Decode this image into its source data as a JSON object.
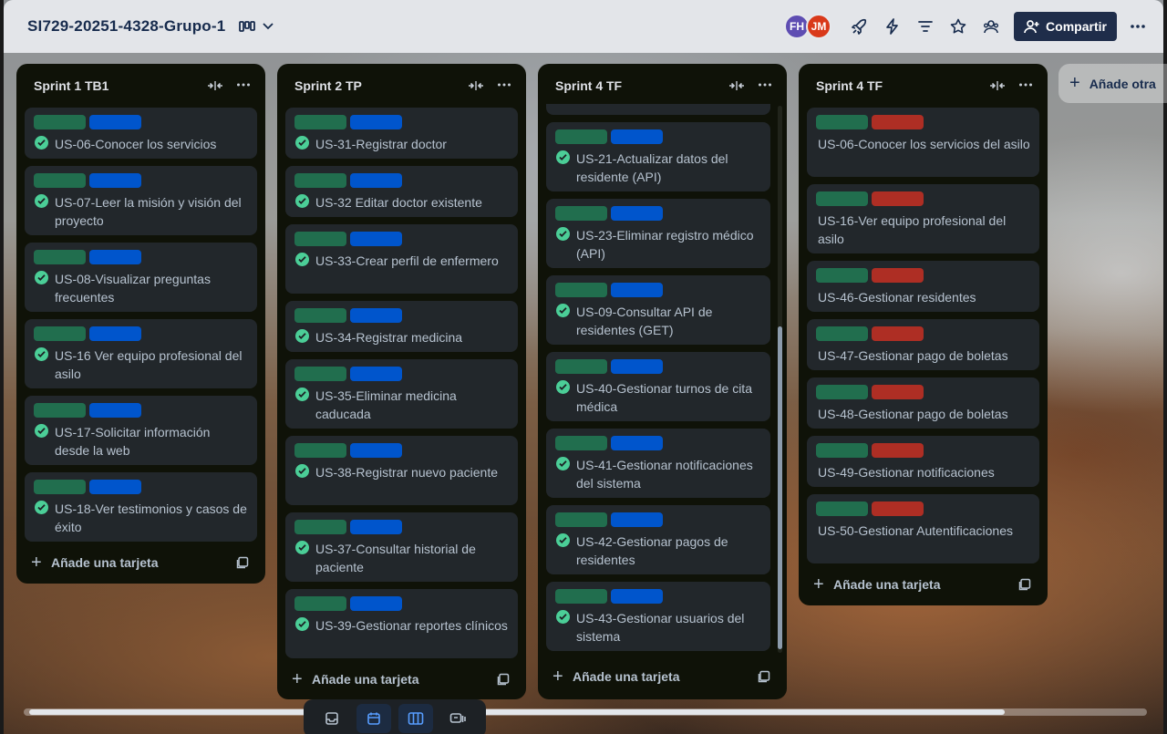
{
  "header": {
    "board_title": "SI729-20251-4328-Grupo-1",
    "share_label": "Compartir",
    "members": [
      "FH",
      "JM"
    ]
  },
  "lists": [
    {
      "title": "Sprint 1 TB1",
      "add_label": "Añade una tarjeta",
      "cards": [
        {
          "text": "US-06-Conocer los servicios",
          "done": true,
          "label2": "blue"
        },
        {
          "text": "US-07-Leer la misión y visión del proyecto",
          "done": true,
          "label2": "blue"
        },
        {
          "text": "US-08-Visualizar preguntas frecuentes",
          "done": true,
          "label2": "blue"
        },
        {
          "text": "US-16 Ver equipo profesional del asilo",
          "done": true,
          "label2": "blue"
        },
        {
          "text": "US-17-Solicitar información desde la web",
          "done": true,
          "label2": "blue"
        },
        {
          "text": "US-18-Ver testimonios y casos de éxito",
          "done": true,
          "label2": "blue"
        }
      ]
    },
    {
      "title": "Sprint 2 TP",
      "add_label": "Añade una tarjeta",
      "cards": [
        {
          "text": "US-31-Registrar doctor",
          "done": true,
          "label2": "blue"
        },
        {
          "text": "US-32 Editar doctor existente",
          "done": true,
          "label2": "blue"
        },
        {
          "text": "US-33-Crear perfil de enfermero",
          "done": true,
          "label2": "blue"
        },
        {
          "text": "US-34-Registrar medicina",
          "done": true,
          "label2": "blue"
        },
        {
          "text": "US-35-Eliminar medicina caducada",
          "done": true,
          "label2": "blue"
        },
        {
          "text": "US-38-Registrar nuevo paciente",
          "done": true,
          "label2": "blue"
        },
        {
          "text": "US-37-Consultar historial de paciente",
          "done": true,
          "label2": "blue"
        },
        {
          "text": "US-39-Gestionar reportes clínicos",
          "done": true,
          "label2": "blue"
        }
      ]
    },
    {
      "title": "Sprint 4 TF",
      "add_label": "Añade una tarjeta",
      "cards": [
        {
          "text": "US-21-Actualizar datos del residente (API)",
          "done": true,
          "label2": "blue"
        },
        {
          "text": "US-23-Eliminar registro médico (API)",
          "done": true,
          "label2": "blue"
        },
        {
          "text": "US-09-Consultar API de residentes (GET)",
          "done": true,
          "label2": "blue"
        },
        {
          "text": "US-40-Gestionar turnos de cita médica",
          "done": true,
          "label2": "blue"
        },
        {
          "text": "US-41-Gestionar notificaciones del sistema",
          "done": true,
          "label2": "blue"
        },
        {
          "text": "US-42-Gestionar pagos de residentes",
          "done": true,
          "label2": "blue"
        },
        {
          "text": "US-43-Gestionar usuarios del sistema",
          "done": true,
          "label2": "blue"
        }
      ]
    },
    {
      "title": "Sprint 4 TF",
      "add_label": "Añade una tarjeta",
      "cards": [
        {
          "text": "US-06-Conocer los servicios del asilo",
          "done": false,
          "label2": "red"
        },
        {
          "text": "US-16-Ver equipo profesional del asilo",
          "done": false,
          "label2": "red"
        },
        {
          "text": "US-46-Gestionar residentes",
          "done": false,
          "label2": "red"
        },
        {
          "text": "US-47-Gestionar pago de boletas",
          "done": false,
          "label2": "red"
        },
        {
          "text": "US-48-Gestionar pago de boletas",
          "done": false,
          "label2": "red"
        },
        {
          "text": "US-49-Gestionar notificaciones",
          "done": false,
          "label2": "red"
        },
        {
          "text": "US-50-Gestionar Autentificaciones",
          "done": false,
          "label2": "red"
        }
      ]
    }
  ],
  "add_list_label": "Añade otra",
  "colors": {
    "label_green": "#216e4e",
    "label_blue": "#0055cc",
    "label_red": "#ae2e24",
    "check_green": "#4bce97",
    "share_bg": "#1f2d4a"
  }
}
